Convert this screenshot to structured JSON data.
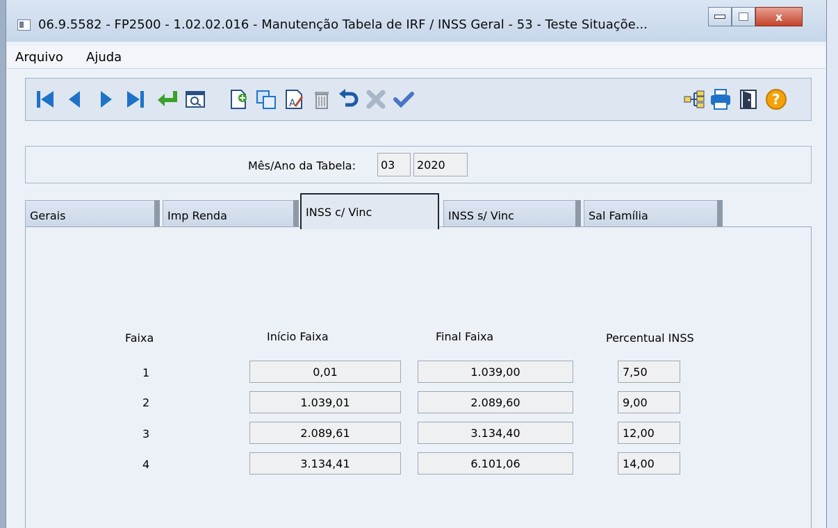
{
  "window": {
    "title": "06.9.5582 - FP2500 - 1.02.02.016 - Manutenção Tabela de IRF / INSS Geral - 53 - Teste Situaçõe...",
    "controls": {
      "minimize_icon": "minimize-icon",
      "maximize_icon": "maximize-icon",
      "close_label": "x"
    }
  },
  "menu": {
    "items": [
      "Arquivo",
      "Ajuda"
    ]
  },
  "toolbar": {
    "left_buttons": [
      "first-record-icon",
      "previous-record-icon",
      "next-record-icon",
      "last-record-icon",
      "enter-icon",
      "search-icon",
      "new-record-icon",
      "copy-icon",
      "edit-icon",
      "delete-icon",
      "undo-icon",
      "cancel-icon",
      "confirm-icon"
    ],
    "right_buttons": [
      "tree-icon",
      "print-icon",
      "exit-door-icon",
      "help-icon"
    ],
    "colors": {
      "nav": "#1e73c8",
      "enter": "#3aa12a",
      "help": "#f5a20a",
      "confirm": "#4a74c8"
    }
  },
  "table_period": {
    "label": "Mês/Ano da Tabela:",
    "month": "03",
    "year": "2020"
  },
  "tabs": [
    {
      "label": "Gerais",
      "active": false
    },
    {
      "label": "Imp Renda",
      "active": false
    },
    {
      "label": "INSS c/ Vinc",
      "active": true
    },
    {
      "label": "INSS s/ Vinc",
      "active": false
    },
    {
      "label": "Sal Família",
      "active": false
    }
  ],
  "inss_table": {
    "headers": {
      "faixa": "Faixa",
      "inicio": "Início Faixa",
      "final": "Final Faixa",
      "percentual": "Percentual INSS"
    },
    "rows": [
      {
        "faixa": "1",
        "inicio": "0,01",
        "final": "1.039,00",
        "percentual": "7,50"
      },
      {
        "faixa": "2",
        "inicio": "1.039,01",
        "final": "2.089,60",
        "percentual": "9,00"
      },
      {
        "faixa": "3",
        "inicio": "2.089,61",
        "final": "3.134,40",
        "percentual": "12,00"
      },
      {
        "faixa": "4",
        "inicio": "3.134,41",
        "final": "6.101,06",
        "percentual": "14,00"
      }
    ]
  }
}
